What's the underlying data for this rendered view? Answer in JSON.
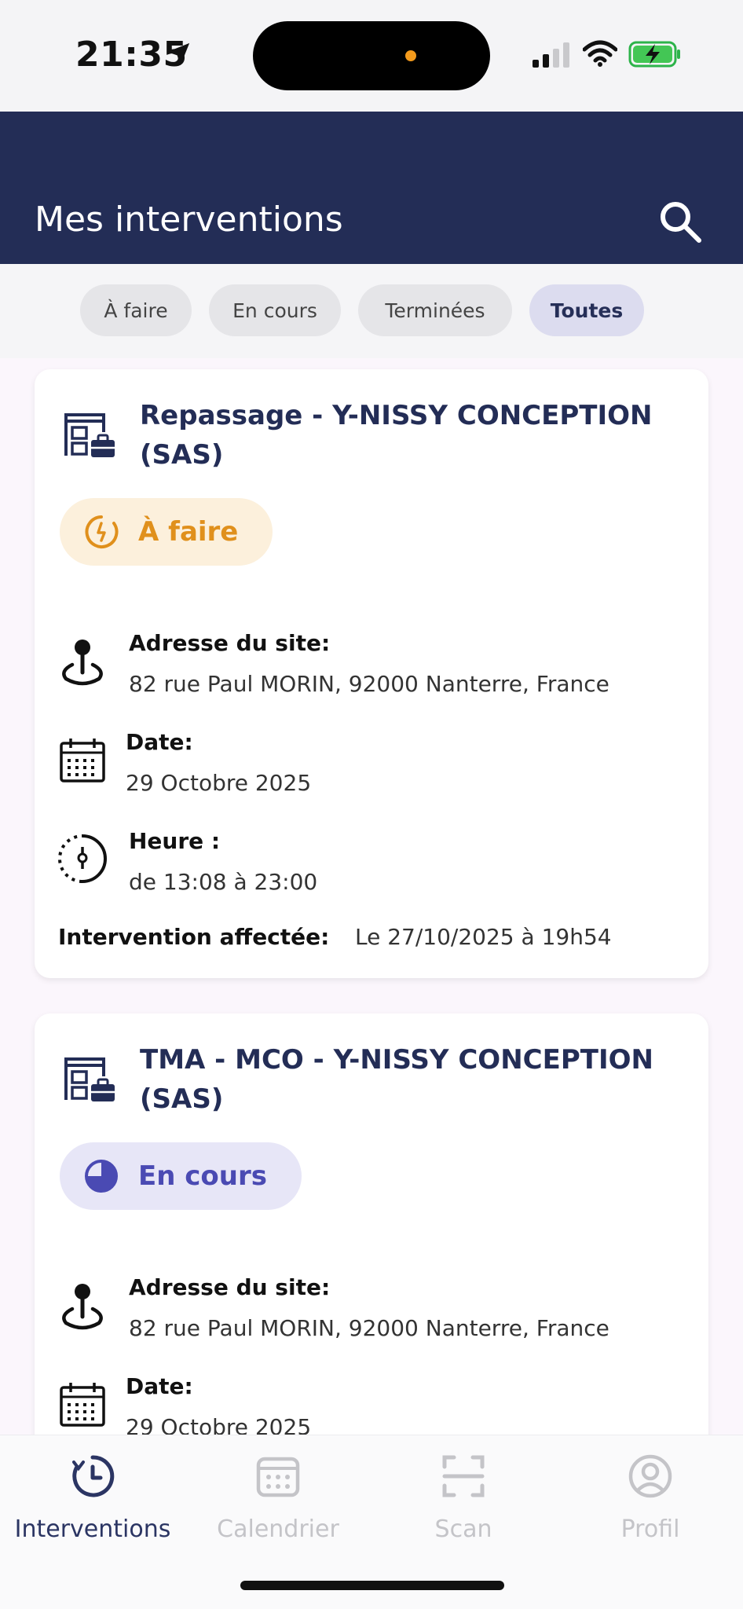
{
  "status_bar": {
    "time": "21:35"
  },
  "header": {
    "title": "Mes interventions"
  },
  "filters": [
    {
      "label": "À faire",
      "active": false
    },
    {
      "label": "En cours",
      "active": false
    },
    {
      "label": "Terminées",
      "active": false
    },
    {
      "label": "Toutes",
      "active": true
    }
  ],
  "interventions": [
    {
      "title": "Repassage - Y-NISSY CONCEPTION (SAS)",
      "status": "À faire",
      "address_label": "Adresse du site:",
      "address": "82 rue Paul MORIN, 92000 Nanterre, France",
      "date_label": "Date:",
      "date": "29 Octobre 2025",
      "time_label": "Heure :",
      "time": "de 13:08 à 23:00",
      "assigned_label": "Intervention affectée:",
      "assigned": "Le 27/10/2025 à 19h54"
    },
    {
      "title": "TMA - MCO - Y-NISSY CONCEPTION (SAS)",
      "status": "En cours",
      "address_label": "Adresse du site:",
      "address": "82 rue Paul MORIN, 92000 Nanterre, France",
      "date_label": "Date:",
      "date": "29 Octobre 2025"
    }
  ],
  "nav": [
    {
      "label": "Interventions",
      "icon": "clock-icon",
      "active": true
    },
    {
      "label": "Calendrier",
      "icon": "calendar-icon",
      "active": false
    },
    {
      "label": "Scan",
      "icon": "scan-icon",
      "active": false
    },
    {
      "label": "Profil",
      "icon": "profile-icon",
      "active": false
    }
  ],
  "colors": {
    "header": "#232d56",
    "todo": "#e0901c",
    "in_progress": "#4a4ab3"
  }
}
